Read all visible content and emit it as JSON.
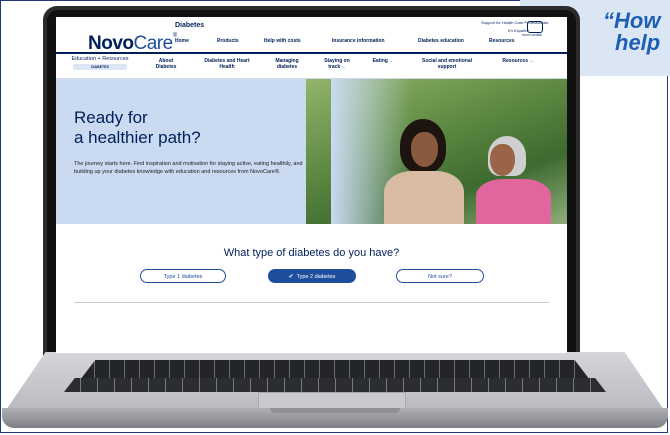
{
  "quote": {
    "text": "“How",
    "text2": "help"
  },
  "header": {
    "logo_bold": "Novo",
    "logo_light": "Care",
    "logo_mark": "®",
    "category": "Diabetes",
    "top_link": "Support for Health Care Professionals",
    "espanol": "En Español",
    "nn_logo": "novo nordisk",
    "nav": [
      {
        "label": "Home"
      },
      {
        "label": "Products"
      },
      {
        "label": "Help with costs"
      },
      {
        "label": "Insurance information"
      },
      {
        "label": "Diabetes education"
      },
      {
        "label": "Resources"
      }
    ]
  },
  "subnav": {
    "edu_title": "Education + Resources",
    "edu_pill": "DIABETES",
    "items": [
      {
        "label": "About Diabetes"
      },
      {
        "label": "Diabetes and Heart Health"
      },
      {
        "label": "Managing diabetes"
      },
      {
        "label": "Staying on track"
      },
      {
        "label": "Eating"
      },
      {
        "label": "Social and emotional support"
      },
      {
        "label": "Resources"
      }
    ]
  },
  "hero": {
    "title_line1": "Ready for",
    "title_line2": "a healthier path?",
    "body": "The journey starts here. Find inspiration and motivation for staying active, eating healthily, and building up your diabetes knowledge with education and resources from NovoCare®."
  },
  "diabetes_type": {
    "question": "What type of diabetes do you have?",
    "options": [
      {
        "label": "Type 1 diabetes",
        "selected": false
      },
      {
        "label": "Type 2 diabetes",
        "selected": true
      },
      {
        "label": "Not sure?",
        "selected": false
      }
    ]
  },
  "colors": {
    "brand_navy": "#00205b",
    "accent_blue": "#1f4e9c",
    "hero_bg": "#c9daf1",
    "quote_blue": "#1d5fb5"
  }
}
